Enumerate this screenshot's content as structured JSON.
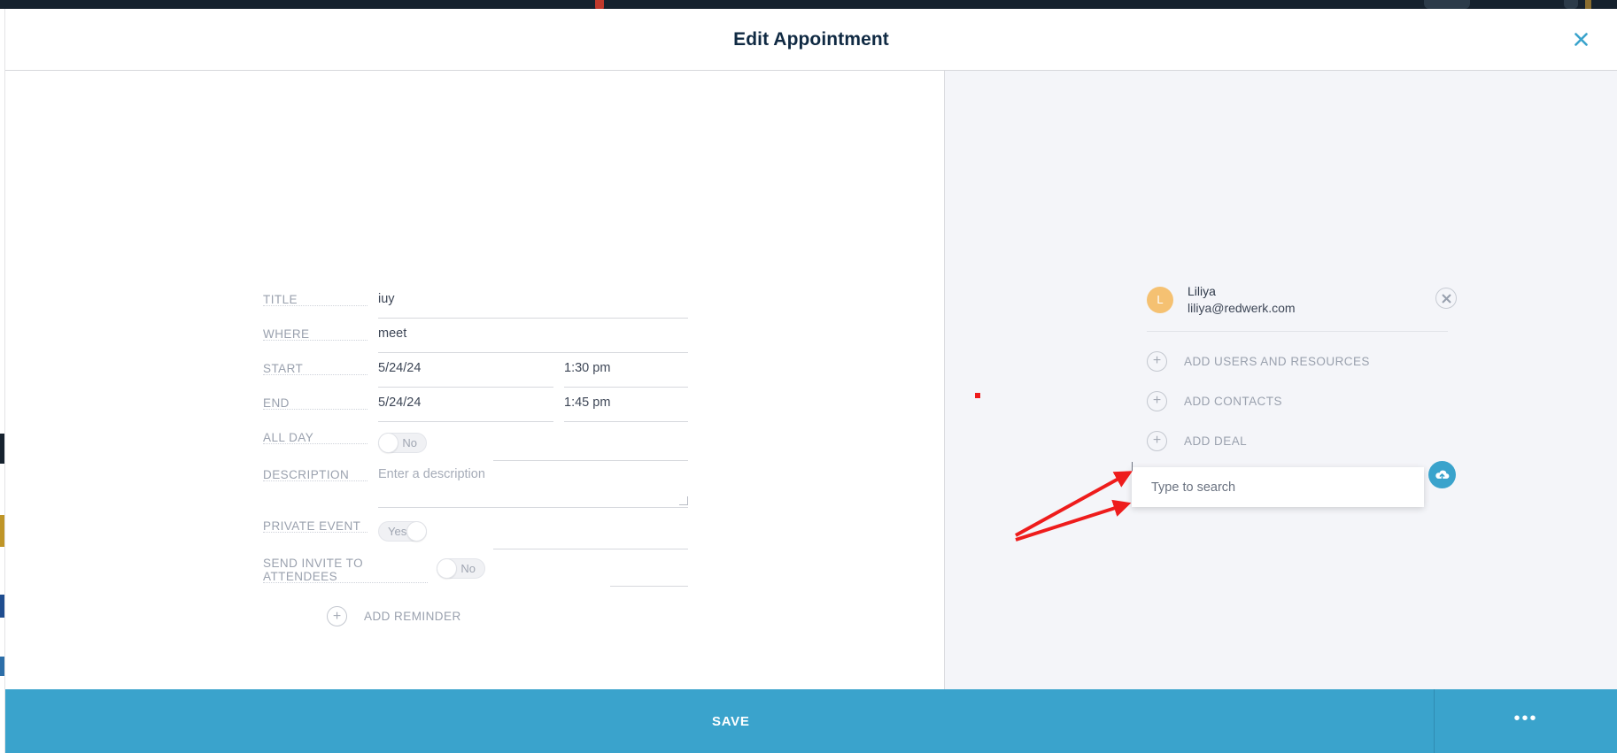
{
  "dialog": {
    "title": "Edit Appointment",
    "close_icon": "close-icon"
  },
  "form": {
    "fields": [
      {
        "label": "TITLE",
        "value": "iuy"
      },
      {
        "label": "WHERE",
        "value": "meet"
      },
      {
        "label": "START",
        "date": "5/24/24",
        "time": "1:30 pm"
      },
      {
        "label": "END",
        "date": "5/24/24",
        "time": "1:45 pm"
      },
      {
        "label": "ALL DAY",
        "toggle_state": "No"
      },
      {
        "label": "DESCRIPTION",
        "placeholder": "Enter a description"
      },
      {
        "label": "PRIVATE EVENT",
        "toggle_state": "Yes"
      },
      {
        "label": "SEND INVITE TO ATTENDEES",
        "toggle_state": "No"
      }
    ],
    "labels": {
      "title": "TITLE",
      "where": "WHERE",
      "start": "START",
      "end": "END",
      "all_day": "ALL DAY",
      "description": "DESCRIPTION",
      "private_event": "PRIVATE EVENT",
      "send_invite": "SEND INVITE TO ATTENDEES"
    },
    "values": {
      "title": "iuy",
      "where": "meet",
      "start_date": "5/24/24",
      "start_time": "1:30 pm",
      "end_date": "5/24/24",
      "end_time": "1:45 pm",
      "all_day": "No",
      "description_placeholder": "Enter a description",
      "private_event": "Yes",
      "send_invite": "No"
    },
    "add_reminder_label": "ADD REMINDER",
    "plus_icon": "plus-icon"
  },
  "attendees": {
    "person": {
      "initial": "L",
      "name": "Liliya",
      "email": "liliya@redwerk.com"
    },
    "remove_icon": "close-circle-icon",
    "actions": [
      {
        "label": "ADD USERS AND RESOURCES",
        "icon": "plus-icon"
      },
      {
        "label": "ADD CONTACTS",
        "icon": "plus-icon"
      },
      {
        "label": "ADD DEAL",
        "icon": "plus-icon"
      }
    ]
  },
  "search": {
    "placeholder": "Type to search",
    "value": ""
  },
  "cloud_badge": {
    "icon": "cloud-upload-icon"
  },
  "footer": {
    "save_label": "SAVE",
    "overflow_label": "•••"
  },
  "colors": {
    "accent": "#3aa3cc",
    "title": "#102a43",
    "label": "#9aa1ae",
    "value": "#3d4656",
    "avatar": "#f5c172",
    "right_pane_bg": "#f4f5f9",
    "annotation": "#ee1c1c"
  }
}
